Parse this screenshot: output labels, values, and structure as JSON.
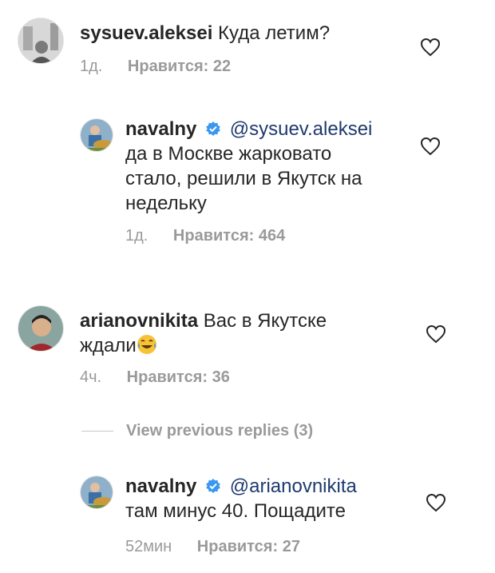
{
  "comments": [
    {
      "username": "sysuev.aleksei",
      "text": "Куда летим?",
      "time": "1д.",
      "likes_label": "Нравится: 22"
    },
    {
      "username": "navalny",
      "mention": "@sysuev.aleksei",
      "text_lines": [
        "да в Москве жарковато",
        "стало, решили в Якутск на",
        "недельку"
      ],
      "time": "1д.",
      "likes_label": "Нравится: 464"
    },
    {
      "username": "arianovnikita",
      "text_line1": "Вас в Якутске",
      "text_line2": "ждали",
      "time": "4ч.",
      "likes_label": "Нравится: 36"
    },
    {
      "username": "navalny",
      "mention": "@arianovnikita",
      "text": "там минус 40. Пощадите",
      "time": "52мин",
      "likes_label": "Нравится: 27"
    }
  ],
  "view_previous": "View previous replies (3)",
  "icons": {
    "heart": "heart-icon",
    "verified": "verified-badge-icon",
    "emoji": "joy-emoji"
  },
  "colors": {
    "verified": "#3897f0",
    "mention": "#1e3a6e",
    "meta": "#9a9a9a"
  }
}
